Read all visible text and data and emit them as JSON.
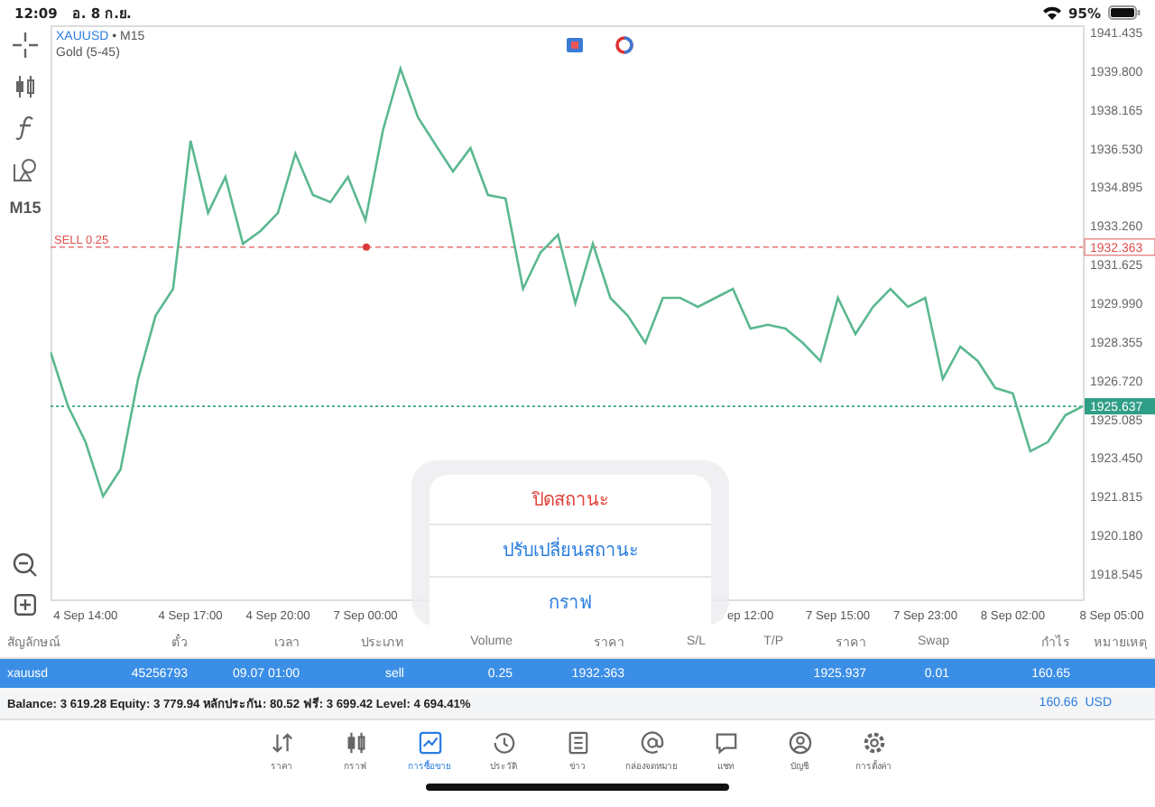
{
  "status_bar": {
    "time": "12:09",
    "date": "อ. 8 ก.ย.",
    "battery": "95%"
  },
  "chart": {
    "symbol": "XAUUSD",
    "separator": "•",
    "timeframe": "M15",
    "indicator": "Gold (5-45)",
    "toolbar_label": "M15",
    "sell_line": {
      "label": "SELL 0.25"
    },
    "last_time_label": "8 Sep 05:00",
    "chart_data": {
      "type": "line",
      "ylim": [
        1917.476,
        1941.74
      ],
      "ref_lines": [
        {
          "axis": "y",
          "value": 1932.363,
          "label": "1932.363",
          "color": "#e57373"
        },
        {
          "axis": "y",
          "value": 1925.637,
          "label": "1925.637",
          "color": "#36a77e"
        }
      ],
      "yticks": [
        {
          "value": 1941.435,
          "label": "1941.435"
        },
        {
          "value": 1939.8,
          "label": "1939.800"
        },
        {
          "value": 1938.165,
          "label": "1938.165"
        },
        {
          "value": 1936.53,
          "label": "1936.530"
        },
        {
          "value": 1934.895,
          "label": "1934.895"
        },
        {
          "value": 1933.26,
          "label": "1933.260"
        },
        {
          "value": 1931.625,
          "label": "1931.625"
        },
        {
          "value": 1929.99,
          "label": "1929.990"
        },
        {
          "value": 1928.355,
          "label": "1928.355"
        },
        {
          "value": 1926.72,
          "label": "1926.720"
        },
        {
          "value": 1925.085,
          "label": "1925.085"
        },
        {
          "value": 1923.45,
          "label": "1923.450"
        },
        {
          "value": 1921.815,
          "label": "1921.815"
        },
        {
          "value": 1920.18,
          "label": "1920.180"
        },
        {
          "value": 1918.545,
          "label": "1918.545"
        }
      ],
      "categories": [
        null,
        null,
        "4 Sep 14:00",
        null,
        null,
        null,
        null,
        null,
        "4 Sep 17:00",
        null,
        null,
        null,
        null,
        "4 Sep 20:00",
        null,
        null,
        null,
        null,
        "7 Sep 00:00",
        null,
        null,
        null,
        null,
        null,
        null,
        null,
        null,
        null,
        null,
        null,
        null,
        null,
        null,
        null,
        null,
        null,
        null,
        null,
        null,
        null,
        "ep 12:00",
        null,
        null,
        null,
        null,
        "7 Sep 15:00",
        null,
        null,
        null,
        null,
        "7 Sep 23:00",
        null,
        null,
        null,
        null,
        "8 Sep 02:00",
        null,
        null,
        null,
        null
      ],
      "series": [
        {
          "color": "#5bb890",
          "values": [
            1927.93,
            1925.64,
            1924.12,
            1921.83,
            1922.97,
            1926.79,
            1929.46,
            1930.6,
            1936.86,
            1933.81,
            1935.33,
            1932.51,
            1933.04,
            1933.81,
            1936.32,
            1934.57,
            1934.26,
            1935.33,
            1933.5,
            1937.31,
            1939.91,
            1937.85,
            1936.7,
            1935.56,
            1936.55,
            1934.57,
            1934.42,
            1930.6,
            1932.13,
            1932.89,
            1929.99,
            1932.51,
            1930.22,
            1929.46,
            1928.31,
            1930.22,
            1930.22,
            1929.84,
            1930.22,
            1930.6,
            1928.92,
            1929.08,
            1928.92,
            1928.31,
            1927.55,
            1930.22,
            1928.69,
            1929.84,
            1930.6,
            1929.84,
            1930.22,
            1926.79,
            1928.16,
            1927.55,
            1926.41,
            1926.18,
            1923.74,
            1924.12,
            1925.26,
            1925.64
          ]
        }
      ]
    }
  },
  "popup": {
    "items": [
      {
        "label": "ปิดสถานะ",
        "kind": "destructive"
      },
      {
        "label": "ปรับเปลี่ยนสถานะ",
        "kind": "default"
      },
      {
        "label": "กราฟ",
        "kind": "default"
      }
    ]
  },
  "table": {
    "columns": [
      "สัญลักษณ์",
      "ตั๋ว",
      "เวลา",
      "ประเภท",
      "Volume",
      "ราคา",
      "S/L",
      "T/P",
      "ราคา",
      "Swap",
      "กำไร",
      "หมายเหตุ"
    ],
    "rows": [
      {
        "selected": true,
        "cells": [
          "xauusd",
          "45256793",
          "09.07 01:00",
          "sell",
          "0.25",
          "1932.363",
          "",
          "",
          "1925.937",
          "0.01",
          "160.65",
          ""
        ]
      }
    ]
  },
  "summary": {
    "text": "Balance: 3 619.28 Equity: 3 779.94 หลักประกัน: 80.52 ฟรี: 3 699.42 Level: 4 694.41%",
    "profit": "160.66",
    "currency": "USD"
  },
  "tabs": [
    {
      "label": "ราคา",
      "selected": false
    },
    {
      "label": "กราฟ",
      "selected": false
    },
    {
      "label": "การซื้อขาย",
      "selected": true
    },
    {
      "label": "ประวัติ",
      "selected": false
    },
    {
      "label": "ข่าว",
      "selected": false
    },
    {
      "label": "กล่องจดหมาย",
      "selected": false
    },
    {
      "label": "แชท",
      "selected": false
    },
    {
      "label": "บัญชี",
      "selected": false
    },
    {
      "label": "การตั้งค่า",
      "selected": false
    }
  ]
}
